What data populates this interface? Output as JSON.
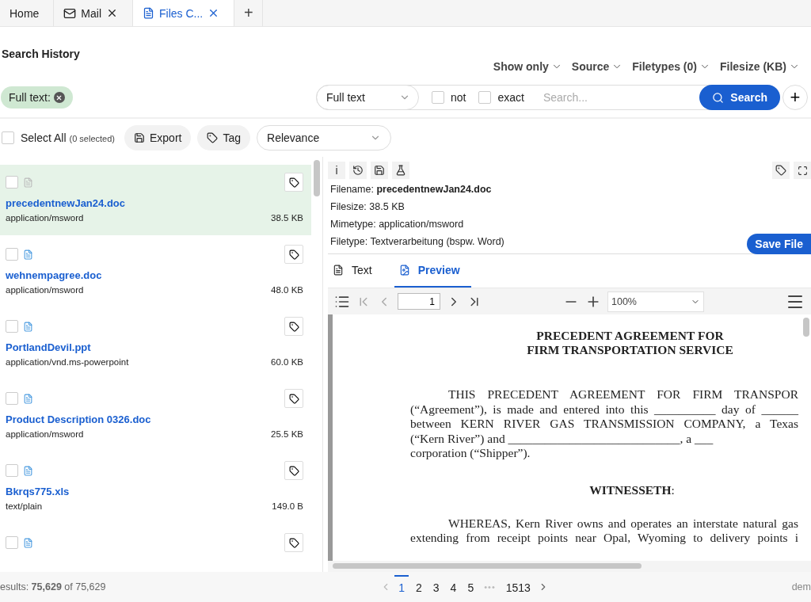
{
  "tabs": [
    {
      "label": "Home",
      "closable": false,
      "selected": false
    },
    {
      "label": "Mail",
      "closable": true,
      "selected": false
    },
    {
      "label": "Files C...",
      "closable": true,
      "selected": true
    }
  ],
  "add_tab": "+",
  "header": {
    "title": "Search History",
    "filters": [
      "Show only",
      "Source",
      "Filetypes (0)",
      "Filesize (KB)"
    ]
  },
  "chip": {
    "label": "Full text:"
  },
  "search": {
    "field_type": "Full text",
    "options": [
      {
        "label": "not",
        "checked": false
      },
      {
        "label": "exact",
        "checked": false
      }
    ],
    "placeholder": "Search...",
    "button": "Search",
    "add": "+"
  },
  "toolbar": {
    "select_all": {
      "label": "Select All",
      "count": "(0 selected)",
      "checked": false
    },
    "buttons": [
      "Export",
      "Tag"
    ],
    "sort": "Relevance"
  },
  "results": [
    {
      "name": "precedentnewJan24.doc",
      "mime": "application/msword",
      "size": "38.5 KB",
      "checked": false,
      "selected": true
    },
    {
      "name": "wehnempagree.doc",
      "mime": "application/msword",
      "size": "48.0 KB",
      "checked": false,
      "selected": false
    },
    {
      "name": "PortlandDevil.ppt",
      "mime": "application/vnd.ms-powerpoint",
      "size": "60.0 KB",
      "checked": false,
      "selected": false
    },
    {
      "name": "Product Description 0326.doc",
      "mime": "application/msword",
      "size": "25.5 KB",
      "checked": false,
      "selected": false
    },
    {
      "name": "Bkrqs775.xls",
      "mime": "text/plain",
      "size": "149.0 B",
      "checked": false,
      "selected": false
    },
    {
      "checked": false,
      "selected": false
    }
  ],
  "details": {
    "info_tools": [
      "i"
    ],
    "fields": [
      {
        "label": "Filename:",
        "value": "precedentnewJan24.doc",
        "bold": true
      },
      {
        "label": "Filesize:",
        "value": "38.5 KB",
        "bold": false
      },
      {
        "label": "Mimetype:",
        "value": "application/msword",
        "bold": false
      },
      {
        "label": "Filetype:",
        "value": "Textverarbeitung (bspw. Word)",
        "bold": false
      }
    ],
    "save": "Save File"
  },
  "view_tabs": [
    {
      "label": "Text",
      "selected": false
    },
    {
      "label": "Preview",
      "selected": true
    }
  ],
  "viewer": {
    "page": "1",
    "zoom": "100%"
  },
  "document": {
    "title": [
      "PRECEDENT AGREEMENT FOR",
      "FIRM TRANSPORTATION SERVICE"
    ],
    "para1": [
      {
        "text": "THIS PRECEDENT AGREEMENT FOR FIRM TRANSPOR",
        "indent": true,
        "justify": true
      },
      {
        "text": "(“Agreement”), is made and entered into this __________ day of ______",
        "indent": false,
        "justify": true
      },
      {
        "text": "between KERN RIVER GAS TRANSMISSION COMPANY, a Texas",
        "indent": false,
        "justify": true
      },
      {
        "text": "(“Kern River”) and ____________________________, a ___",
        "indent": false,
        "justify": false
      },
      {
        "text": "corporation (“Shipper”).",
        "indent": false,
        "justify": false
      }
    ],
    "heading": "**WITNESSETH**:",
    "para2": [
      {
        "text": "WHEREAS, Kern River owns and operates an interstate natural gas",
        "indent": true,
        "justify": true
      },
      {
        "text": "extending from receipt points near Opal, Wyoming to delivery points i",
        "indent": false,
        "justify": true
      }
    ]
  },
  "status": {
    "results": "esults: **75,629** of 75,629",
    "pages": [
      {
        "label": "1",
        "selected": true
      },
      {
        "label": "2",
        "selected": false
      },
      {
        "label": "3",
        "selected": false
      },
      {
        "label": "4",
        "selected": false
      },
      {
        "label": "5",
        "selected": false
      }
    ],
    "ellipsis": "•••",
    "last_page": "1513",
    "user": "dem"
  }
}
